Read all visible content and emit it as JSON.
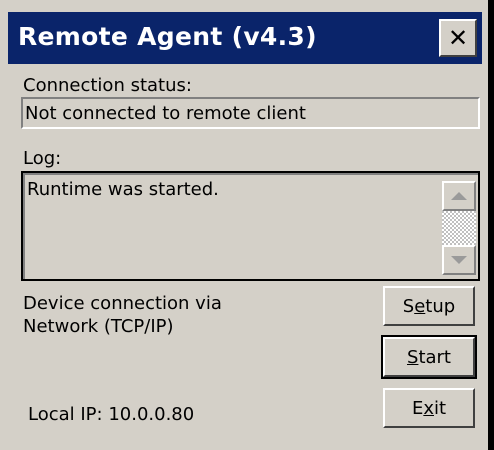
{
  "window": {
    "title": "Remote Agent (v4.3)",
    "close_glyph": "✕"
  },
  "connection": {
    "label": "Connection status:",
    "value": "Not connected to remote client"
  },
  "log": {
    "label": "Log:",
    "text": "Runtime was started."
  },
  "device": {
    "line1": "Device connection via",
    "line2": "Network (TCP/IP)"
  },
  "local_ip": "Local IP: 10.0.0.80",
  "buttons": {
    "setup": {
      "before": "S",
      "accel": "e",
      "after": "tup"
    },
    "start": {
      "before": "",
      "accel": "S",
      "after": "tart"
    },
    "exit": {
      "before": "E",
      "accel": "x",
      "after": "it"
    }
  },
  "icons": {
    "close": "close-icon",
    "scroll_up": "arrow-up-icon",
    "scroll_down": "arrow-down-icon"
  }
}
